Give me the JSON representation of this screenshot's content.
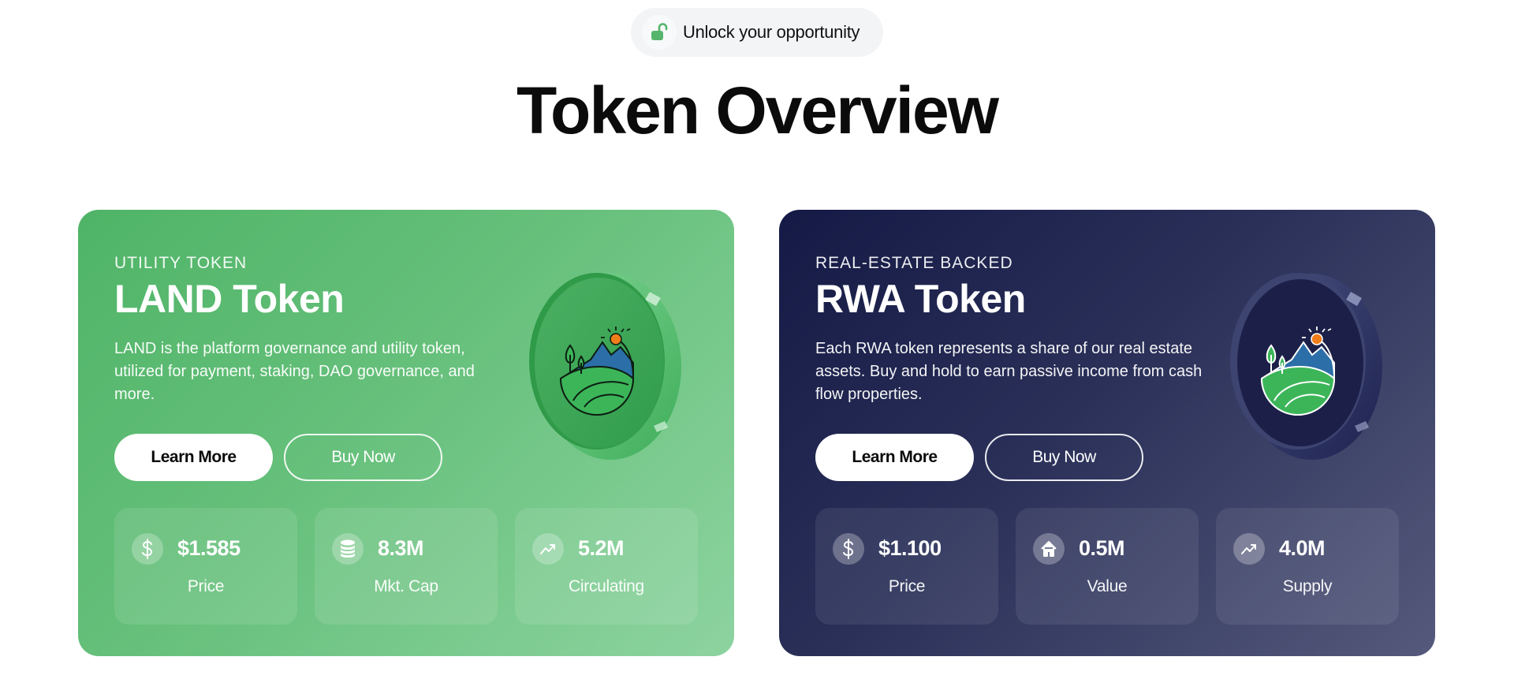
{
  "header": {
    "badge_icon": "unlock-icon",
    "badge_text": "Unlock your opportunity",
    "title": "Token Overview"
  },
  "colors": {
    "accent_green": "#55b56c",
    "navy": "#1a1f4a",
    "sun_orange": "#ef7d1a",
    "mountain_blue": "#2b6ea8"
  },
  "cards": [
    {
      "eyebrow": "UTILITY TOKEN",
      "title": "LAND Token",
      "description": "LAND is the platform governance and utility token, utilized for payment, staking, DAO governance, and more.",
      "primary_button": "Learn More",
      "secondary_button": "Buy Now",
      "coin_icon": "landscape-logo-icon",
      "stats": [
        {
          "icon": "dollar-icon",
          "value": "$1.585",
          "label": "Price"
        },
        {
          "icon": "coins-stack-icon",
          "value": "8.3M",
          "label": "Mkt. Cap"
        },
        {
          "icon": "trending-up-icon",
          "value": "5.2M",
          "label": "Circulating"
        }
      ]
    },
    {
      "eyebrow": "REAL-ESTATE BACKED",
      "title": "RWA Token",
      "description": "Each RWA token represents a share of our real estate assets. Buy and hold to earn passive income from cash flow properties.",
      "primary_button": "Learn More",
      "secondary_button": "Buy Now",
      "coin_icon": "landscape-logo-icon",
      "stats": [
        {
          "icon": "dollar-icon",
          "value": "$1.100",
          "label": "Price"
        },
        {
          "icon": "home-icon",
          "value": "0.5M",
          "label": "Value"
        },
        {
          "icon": "trending-up-icon",
          "value": "4.0M",
          "label": "Supply"
        }
      ]
    }
  ]
}
